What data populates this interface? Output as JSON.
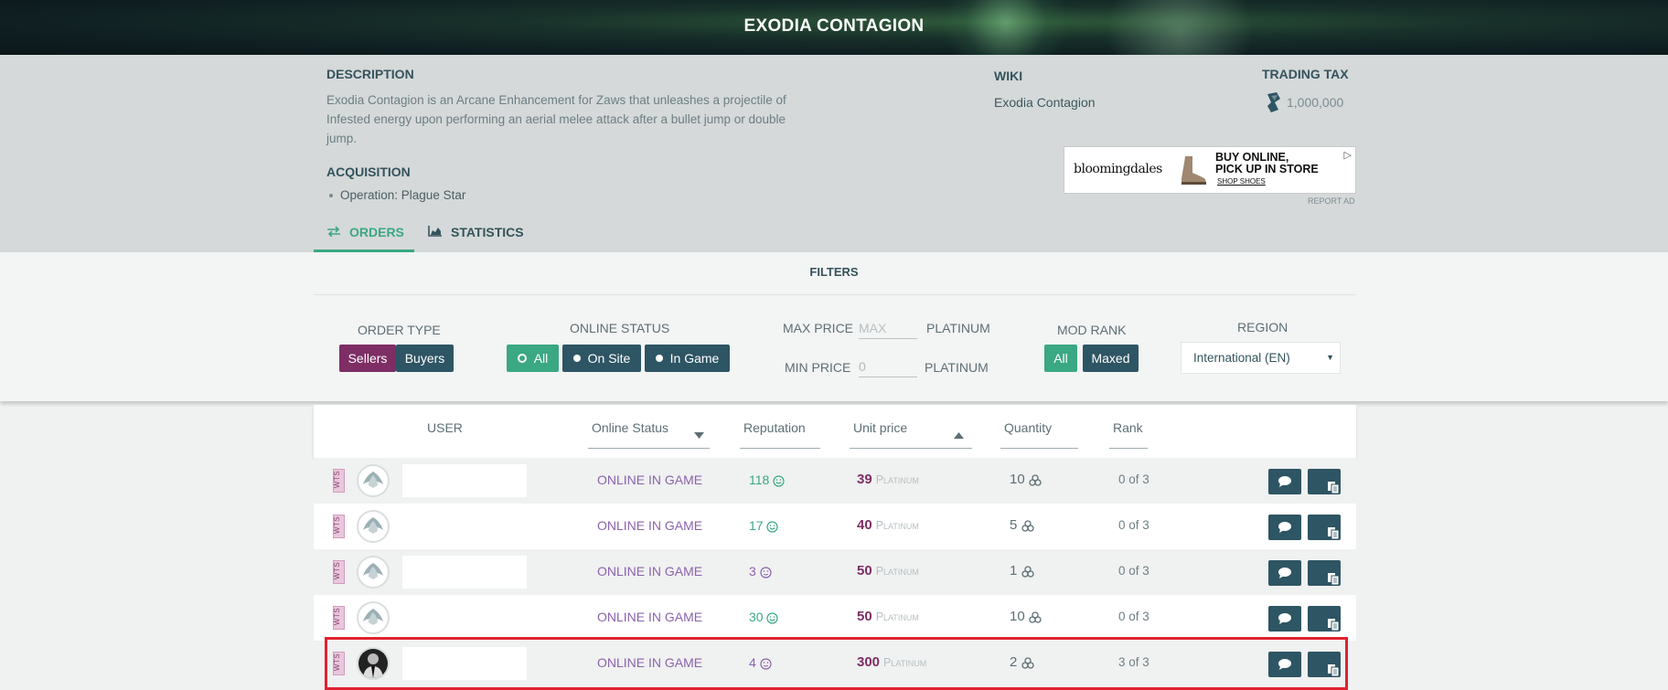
{
  "item": {
    "title": "EXODIA CONTAGION"
  },
  "description": {
    "label": "DESCRIPTION",
    "text": "Exodia Contagion is an Arcane Enhancement for Zaws that unleashes a projectile of Infested energy upon performing an aerial melee attack after a bullet jump or double jump."
  },
  "acquisition": {
    "label": "ACQUISITION",
    "items": [
      "Operation: Plague Star"
    ]
  },
  "wiki": {
    "label": "WIKI",
    "link": "Exodia Contagion"
  },
  "trading_tax": {
    "label": "TRADING TAX",
    "value": "1,000,000",
    "icon": "credits-icon"
  },
  "ad": {
    "brand": "bloomingdales",
    "headline_line1": "BUY ONLINE,",
    "headline_line2": "PICK UP IN STORE",
    "cta": "SHOP SHOES",
    "report": "REPORT AD"
  },
  "tabs": [
    {
      "label": "ORDERS",
      "icon": "swap-arrows-icon",
      "active": true
    },
    {
      "label": "STATISTICS",
      "icon": "area-chart-icon",
      "active": false
    }
  ],
  "filters": {
    "title": "FILTERS",
    "order_type": {
      "label": "ORDER TYPE",
      "options": [
        "Sellers",
        "Buyers"
      ],
      "selected": "Sellers"
    },
    "online_status": {
      "label": "ONLINE STATUS",
      "options": [
        "All",
        "On Site",
        "In Game"
      ],
      "selected": "All"
    },
    "max_price": {
      "label": "MAX PRICE",
      "placeholder": "MAX",
      "unit": "PLATINUM"
    },
    "min_price": {
      "label": "MIN PRICE",
      "value": "0",
      "unit": "PLATINUM"
    },
    "mod_rank": {
      "label": "MOD RANK",
      "options": [
        "All",
        "Maxed"
      ],
      "selected": "All"
    },
    "region": {
      "label": "REGION",
      "selected": "International (EN)"
    }
  },
  "table": {
    "headers": {
      "user": "USER",
      "online_status": "Online Status",
      "reputation": "Reputation",
      "unit_price": "Unit price",
      "quantity": "Quantity",
      "rank": "Rank"
    },
    "rows": [
      {
        "type": "WTS",
        "status": "ONLINE IN GAME",
        "reputation": "118",
        "rep_icon": "happy-face-icon",
        "price": "39",
        "price_unit": "Platinum",
        "quantity": "10",
        "rank": "0 of 3"
      },
      {
        "type": "WTS",
        "status": "ONLINE IN GAME",
        "reputation": "17",
        "rep_icon": "happy-face-icon",
        "price": "40",
        "price_unit": "Platinum",
        "quantity": "5",
        "rank": "0 of 3"
      },
      {
        "type": "WTS",
        "status": "ONLINE IN GAME",
        "reputation": "3",
        "rep_icon": "neutral-face-icon",
        "price": "50",
        "price_unit": "Platinum",
        "quantity": "1",
        "rank": "0 of 3"
      },
      {
        "type": "WTS",
        "status": "ONLINE IN GAME",
        "reputation": "30",
        "rep_icon": "happy-face-icon",
        "price": "50",
        "price_unit": "Platinum",
        "quantity": "10",
        "rank": "0 of 3"
      },
      {
        "type": "WTS",
        "status": "ONLINE IN GAME",
        "reputation": "4",
        "rep_icon": "neutral-face-icon",
        "price": "300",
        "price_unit": "Platinum",
        "quantity": "2",
        "rank": "3 of 3"
      }
    ]
  },
  "colors": {
    "accent_green": "#3aa882",
    "dark_teal": "#2e5563",
    "purple": "#7e2e64",
    "status_purple": "#8b63ad",
    "highlight_red": "#e0222e"
  }
}
